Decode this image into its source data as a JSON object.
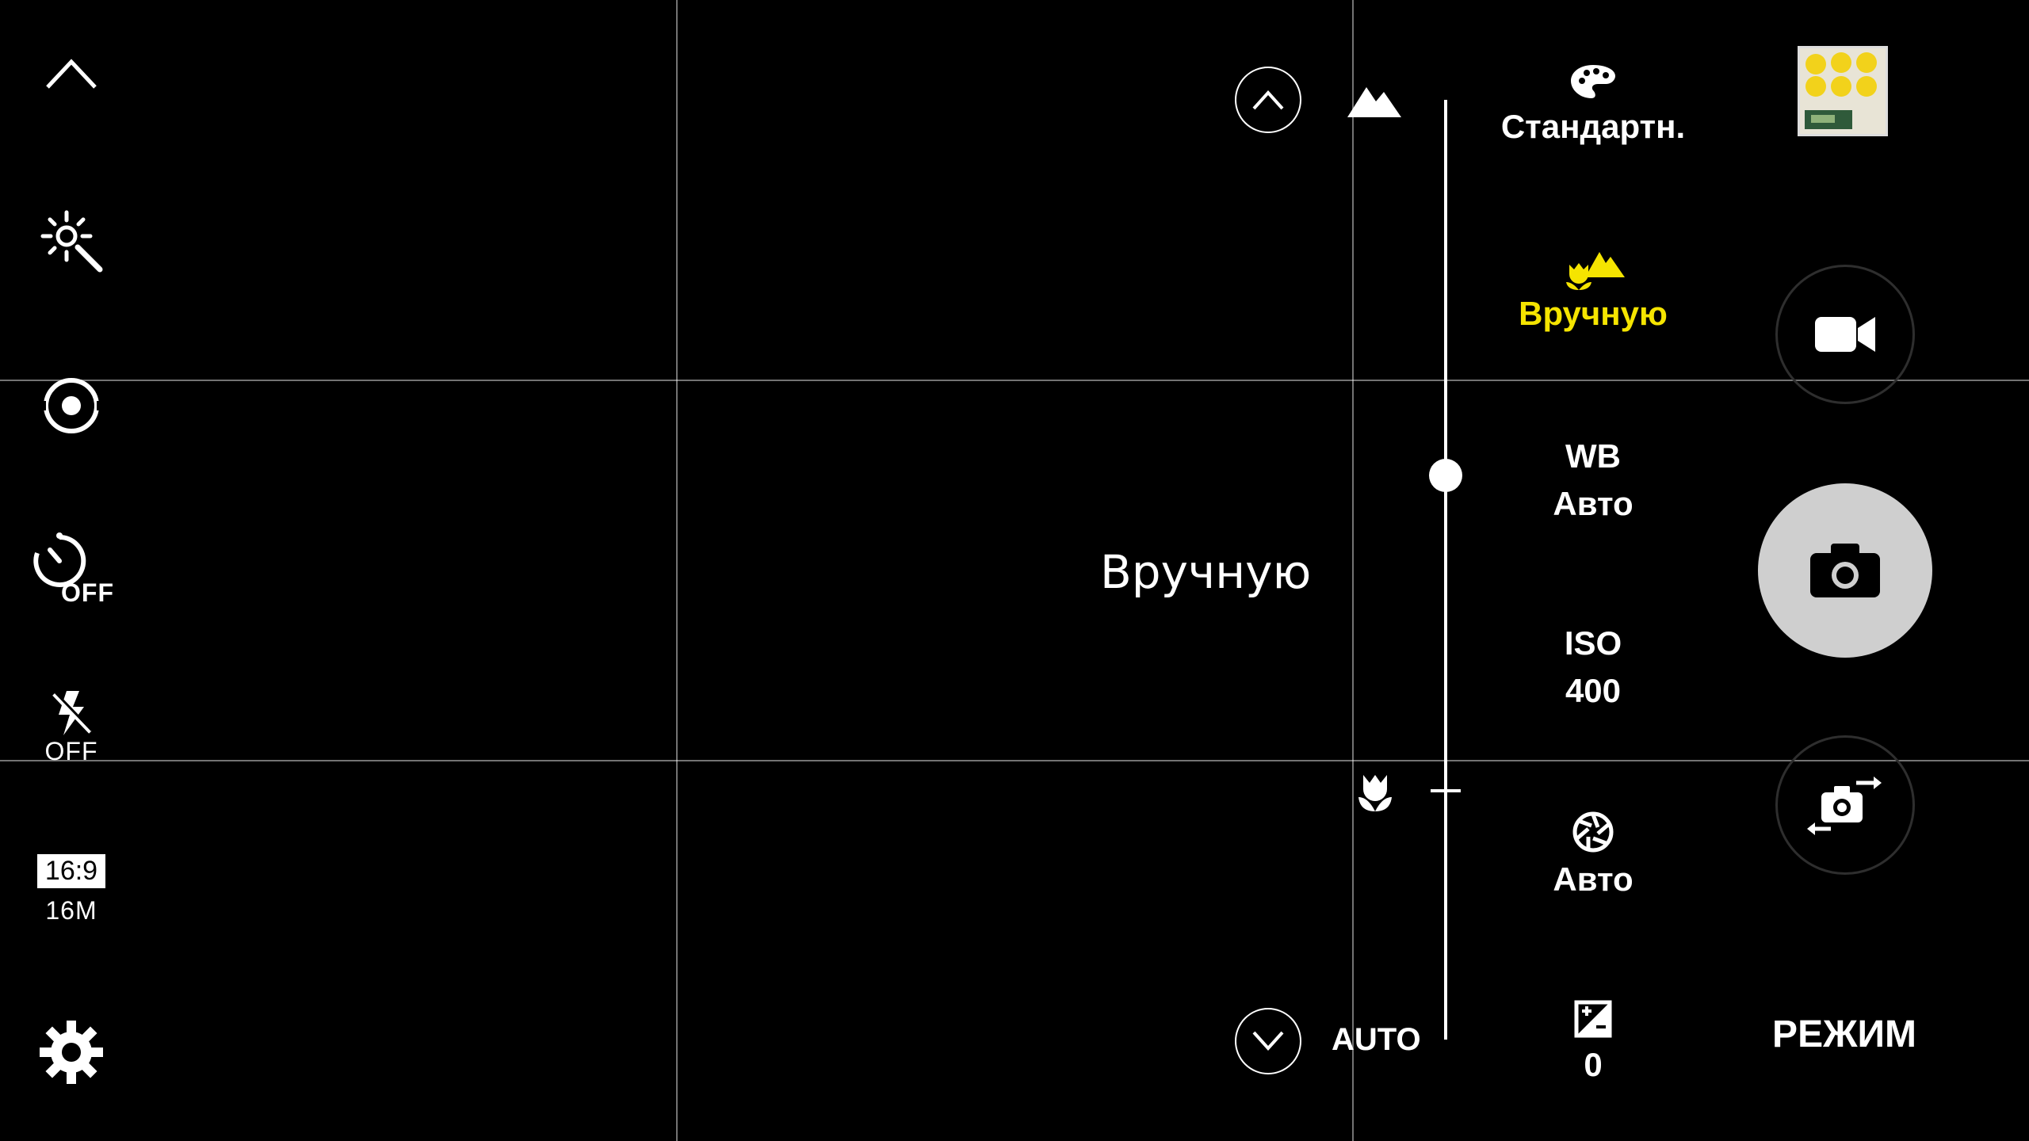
{
  "left_toolbar": {
    "timer_state": "OFF",
    "flash_state": "OFF",
    "ratio": "16:9",
    "resolution": "16M"
  },
  "viewfinder": {
    "mode_overlay": "Вручную"
  },
  "focus": {
    "auto_label": "AUTO",
    "slider_position": 0.4
  },
  "settings": {
    "color_tone": "Стандартн.",
    "focus_mode": "Вручную",
    "wb_title": "WB",
    "wb_value": "Авто",
    "iso_title": "ISO",
    "iso_value": "400",
    "shutter_value": "Авто",
    "exposure_value": "0"
  },
  "right_panel": {
    "mode_label": "РЕЖИМ"
  },
  "colors": {
    "accent": "#f5e400",
    "background": "#000000",
    "shutter": "#cfcfcf"
  }
}
